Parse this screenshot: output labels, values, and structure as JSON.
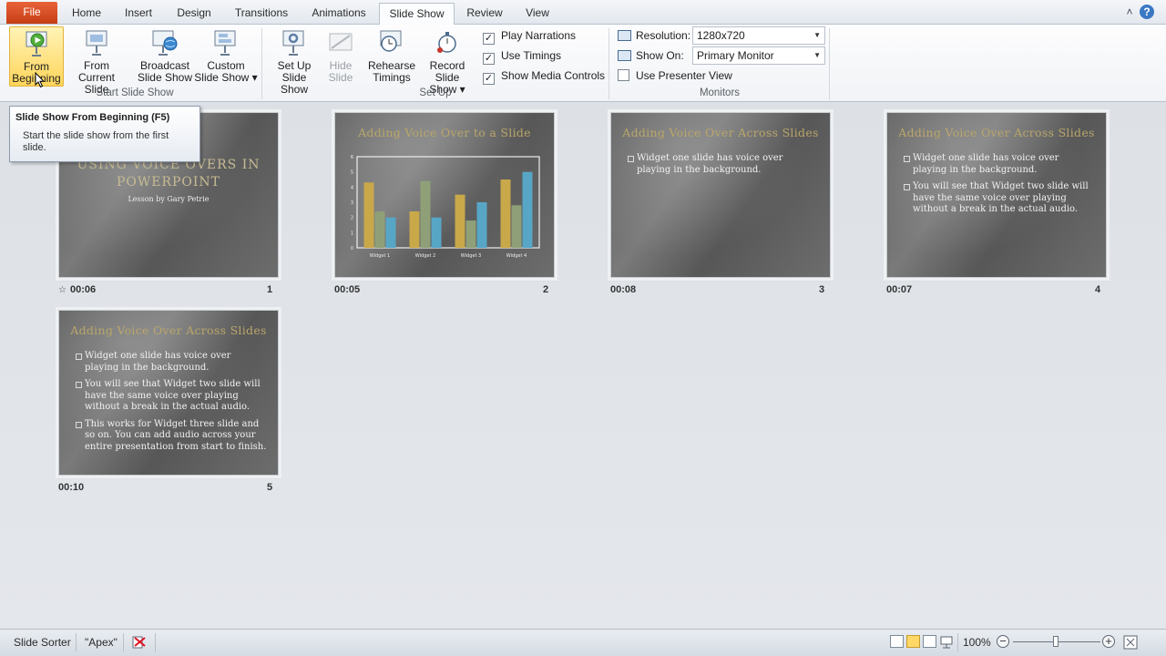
{
  "tabs": [
    "File",
    "Home",
    "Insert",
    "Design",
    "Transitions",
    "Animations",
    "Slide Show",
    "Review",
    "View"
  ],
  "active_tab": "Slide Show",
  "ribbon": {
    "start_group": {
      "label": "Start Slide Show",
      "from_beginning": [
        "From",
        "Beginning"
      ],
      "from_current": [
        "From",
        "Current Slide"
      ],
      "broadcast": [
        "Broadcast",
        "Slide Show"
      ],
      "custom": [
        "Custom",
        "Slide Show ▾"
      ]
    },
    "setup_group": {
      "label": "Set Up",
      "setup": [
        "Set Up",
        "Slide Show"
      ],
      "hide": [
        "Hide",
        "Slide"
      ],
      "rehearse": [
        "Rehearse",
        "Timings"
      ],
      "record": [
        "Record Slide",
        "Show ▾"
      ],
      "checks": [
        {
          "label": "Play Narrations",
          "checked": true
        },
        {
          "label": "Use Timings",
          "checked": true
        },
        {
          "label": "Show Media Controls",
          "checked": true
        }
      ]
    },
    "monitors_group": {
      "label": "Monitors",
      "resolution_label": "Resolution:",
      "resolution_value": "1280x720",
      "show_on_label": "Show On:",
      "show_on_value": "Primary Monitor",
      "presenter_view": {
        "label": "Use Presenter View",
        "checked": false
      }
    }
  },
  "tooltip": {
    "title": "Slide Show From Beginning (F5)",
    "body": "Start the slide show from the first slide."
  },
  "slides": [
    {
      "number": "1",
      "time": "00:06",
      "title_lines": [
        "USING VOICE OVERS IN",
        "POWERPOINT"
      ],
      "subtitle": "Lesson by Gary Petrie"
    },
    {
      "number": "2",
      "time": "00:05",
      "title": "Adding  Voice Over to a Slide",
      "chart_data": {
        "type": "bar",
        "categories": [
          "Widget 1",
          "Widget 2",
          "Widget 3",
          "Widget 4"
        ],
        "series": [
          {
            "values": [
              4.3,
              2.4,
              3.5,
              4.5
            ],
            "color": "#c9a84a"
          },
          {
            "values": [
              2.4,
              4.4,
              1.8,
              2.8
            ],
            "color": "#8fa078"
          },
          {
            "values": [
              2.0,
              2.0,
              3.0,
              5.0
            ],
            "color": "#57a6c6"
          }
        ],
        "ylim": [
          0,
          6
        ],
        "yticks": [
          0,
          1,
          2,
          3,
          4,
          5,
          6
        ]
      }
    },
    {
      "number": "3",
      "time": "00:08",
      "title": "Adding Voice Over Across Slides",
      "bullets": [
        "Widget one slide has voice over playing in the background."
      ]
    },
    {
      "number": "4",
      "time": "00:07",
      "title": "Adding Voice Over Across Slides",
      "bullets": [
        "Widget one slide has voice over playing in the background.",
        "You will see that Widget two slide will have the same voice over playing without a break in the actual audio."
      ]
    },
    {
      "number": "5",
      "time": "00:10",
      "title": "Adding Voice Over Across Slides",
      "bullets": [
        "Widget one slide has voice over playing in the background.",
        "You will see that Widget two slide will have the same voice over playing without a break in the actual audio.",
        "This works for Widget three slide and so on. You can add audio across your entire presentation from start to finish."
      ]
    }
  ],
  "status": {
    "view_name": "Slide Sorter",
    "theme": "\"Apex\"",
    "zoom": "100%"
  }
}
